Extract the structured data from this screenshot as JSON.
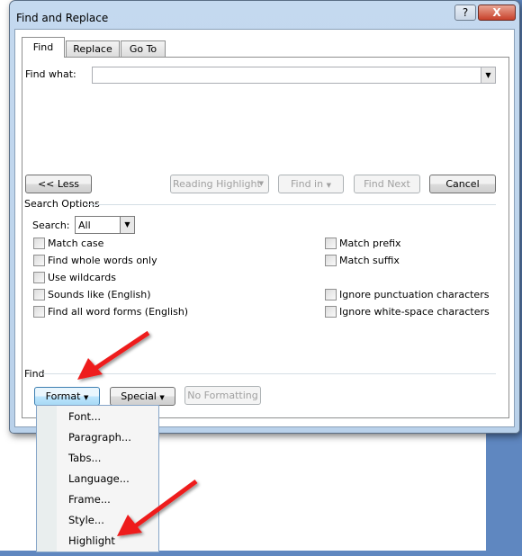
{
  "window": {
    "title": "Find and Replace",
    "help": "?",
    "close": "X"
  },
  "tabs": [
    {
      "label": "Find",
      "active": true
    },
    {
      "label": "Replace"
    },
    {
      "label": "Go To"
    }
  ],
  "find_what": {
    "label": "Find what:",
    "value": ""
  },
  "buttons": {
    "less": "<< Less",
    "reading_highlight": "Reading Highlight",
    "find_in": "Find in",
    "find_next": "Find Next",
    "cancel": "Cancel"
  },
  "search_options": {
    "heading": "Search Options",
    "search_label": "Search:",
    "search_value": "All",
    "left": [
      {
        "label": "Match case",
        "checked": false
      },
      {
        "label": "Find whole words only",
        "checked": false
      },
      {
        "label": "Use wildcards",
        "checked": false
      },
      {
        "label": "Sounds like (English)",
        "checked": false
      },
      {
        "label": "Find all word forms (English)",
        "checked": false
      }
    ],
    "right": [
      {
        "label": "Match prefix",
        "checked": false
      },
      {
        "label": "Match suffix",
        "checked": false
      },
      {
        "label": "Ignore punctuation characters",
        "checked": false
      },
      {
        "label": "Ignore white-space characters",
        "checked": false
      }
    ]
  },
  "find_section": {
    "heading": "Find",
    "format": "Format",
    "special": "Special",
    "no_formatting": "No Formatting"
  },
  "format_menu": [
    "Font...",
    "Paragraph...",
    "Tabs...",
    "Language...",
    "Frame...",
    "Style...",
    "Highlight"
  ],
  "colors": {
    "arrow": "#ee1c1c",
    "desktop": "#5f87c0"
  }
}
